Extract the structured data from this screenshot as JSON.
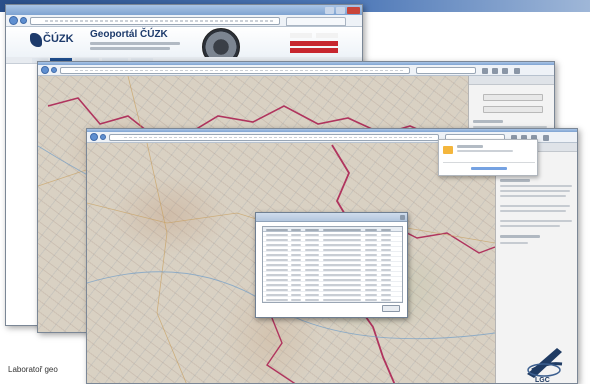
{
  "header": {
    "brand": "ČÚZK",
    "portal_title": "Geoportál ČÚZK"
  },
  "dialog": {
    "title": ""
  },
  "footer": {
    "text": "Laboratoř geo"
  },
  "logo": {
    "text": "LGC"
  },
  "colors": {
    "boundary": "#b0345e",
    "title_blue": "#7fa3d1",
    "brand_blue": "#1c3a6b",
    "folder": "#f4b63c"
  }
}
